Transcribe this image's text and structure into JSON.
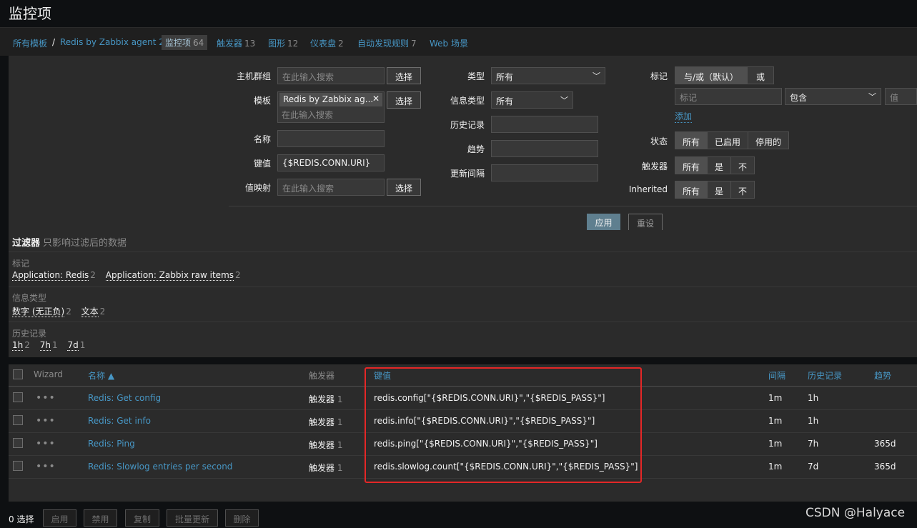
{
  "page": {
    "title": "监控项"
  },
  "breadcrumb": [
    {
      "label": "所有模板",
      "count": ""
    },
    {
      "label": "Redis by Zabbix agent 2",
      "count": ""
    },
    {
      "label": "监控项",
      "count": "64"
    },
    {
      "label": "触发器",
      "count": "13"
    },
    {
      "label": "图形",
      "count": "12"
    },
    {
      "label": "仪表盘",
      "count": "2"
    },
    {
      "label": "自动发现规则",
      "count": "7"
    },
    {
      "label": "Web 场景",
      "count": ""
    }
  ],
  "breadcrumb_sep": "/",
  "filter": {
    "host_group": {
      "label": "主机群组",
      "placeholder": "在此输入搜索",
      "btn": "选择"
    },
    "template": {
      "label": "模板",
      "chip": "Redis by Zabbix ag...",
      "chip_close": "✕",
      "placeholder": "在此输入搜索",
      "btn": "选择"
    },
    "name": {
      "label": "名称",
      "value": ""
    },
    "key": {
      "label": "键值",
      "value": "{$REDIS.CONN.URI}"
    },
    "value_map": {
      "label": "值映射",
      "placeholder": "在此输入搜索",
      "btn": "选择"
    },
    "type": {
      "label": "类型",
      "value": "所有"
    },
    "info_type": {
      "label": "信息类型",
      "value": "所有"
    },
    "history": {
      "label": "历史记录",
      "value": ""
    },
    "trends": {
      "label": "趋势",
      "value": ""
    },
    "interval": {
      "label": "更新间隔",
      "value": ""
    },
    "tags": {
      "label": "标记",
      "options": [
        "与/或（默认）",
        "或"
      ],
      "tag_placeholder": "标记",
      "operator": "包含",
      "value_placeholder": "值",
      "add": "添加"
    },
    "status": {
      "label": "状态",
      "options": [
        "所有",
        "已启用",
        "停用的"
      ]
    },
    "triggers": {
      "label": "触发器",
      "options": [
        "所有",
        "是",
        "不"
      ]
    },
    "inherited": {
      "label": "Inherited",
      "options": [
        "所有",
        "是",
        "不"
      ]
    },
    "apply": "应用",
    "reset": "重设"
  },
  "summary": {
    "title": "过滤器",
    "hint": "只影响过滤后的数据",
    "groups": [
      {
        "title": "标记",
        "items": [
          {
            "label": "Application: Redis",
            "count": "2"
          },
          {
            "label": "Application: Zabbix raw items",
            "count": "2"
          }
        ]
      },
      {
        "title": "信息类型",
        "items": [
          {
            "label": "数字 (无正负)",
            "count": "2"
          },
          {
            "label": "文本",
            "count": "2"
          }
        ]
      },
      {
        "title": "历史记录",
        "items": [
          {
            "label": "1h",
            "count": "2"
          },
          {
            "label": "7h",
            "count": "1"
          },
          {
            "label": "7d",
            "count": "1"
          }
        ]
      }
    ]
  },
  "table": {
    "headers": {
      "wizard": "Wizard",
      "name": "名称 ▲",
      "triggers": "触发器",
      "key": "键值",
      "interval": "间隔",
      "history": "历史记录",
      "trends": "趋势"
    },
    "dots": "•••",
    "rows": [
      {
        "name": "Redis: Get config",
        "trigger": "触发器",
        "trigger_count": "1",
        "key": "redis.config[\"{$REDIS.CONN.URI}\",\"{$REDIS_PASS}\"]",
        "interval": "1m",
        "history": "1h",
        "trends": ""
      },
      {
        "name": "Redis: Get info",
        "trigger": "触发器",
        "trigger_count": "1",
        "key": "redis.info[\"{$REDIS.CONN.URI}\",\"{$REDIS_PASS}\"]",
        "interval": "1m",
        "history": "1h",
        "trends": ""
      },
      {
        "name": "Redis: Ping",
        "trigger": "触发器",
        "trigger_count": "1",
        "key": "redis.ping[\"{$REDIS.CONN.URI}\",\"{$REDIS_PASS}\"]",
        "interval": "1m",
        "history": "7h",
        "trends": "365d"
      },
      {
        "name": "Redis: Slowlog entries per second",
        "trigger": "触发器",
        "trigger_count": "1",
        "key": "redis.slowlog.count[\"{$REDIS.CONN.URI}\",\"{$REDIS_PASS}\"]",
        "interval": "1m",
        "history": "7d",
        "trends": "365d"
      }
    ]
  },
  "footer": {
    "selected": "0 选择",
    "buttons": [
      "启用",
      "禁用",
      "复制",
      "批量更新",
      "删除"
    ]
  },
  "watermark": "CSDN @Halyace"
}
